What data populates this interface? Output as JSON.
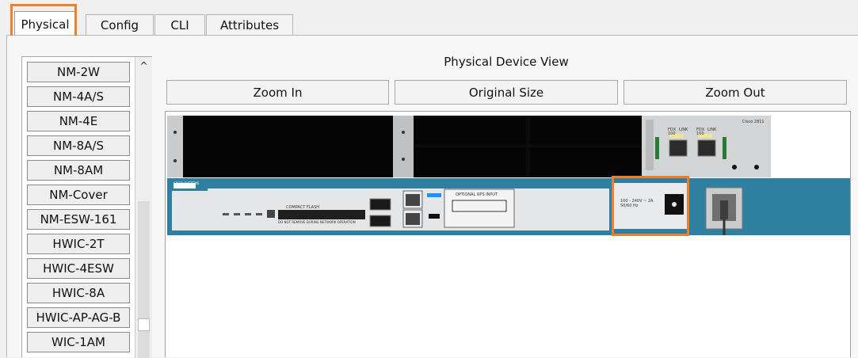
{
  "tabs": [
    {
      "label": "Physical",
      "active": true
    },
    {
      "label": "Config",
      "active": false
    },
    {
      "label": "CLI",
      "active": false
    },
    {
      "label": "Attributes",
      "active": false
    }
  ],
  "modules": [
    "NM-2W",
    "NM-4A/S",
    "NM-4E",
    "NM-8A/S",
    "NM-8AM",
    "NM-Cover",
    "NM-ESW-161",
    "HWIC-2T",
    "HWIC-4ESW",
    "HWIC-8A",
    "HWIC-AP-AG-B",
    "WIC-1AM"
  ],
  "device_view": {
    "title": "Physical Device View",
    "zoom_in": "Zoom In",
    "original_size": "Original Size",
    "zoom_out": "Zoom Out"
  },
  "router": {
    "brand": "Cisco 2811",
    "logo": "CISCO SYSTEMS",
    "compact_flash": "COMPACT FLASH",
    "cf_warning": "DO NOT REMOVE DURING NETWORK OPERATION",
    "rps_label": "OPTIONAL RPS INPUT",
    "power_rating": "100 - 240V ~ 2A 50/60 Hz",
    "port_labels": [
      "FDX",
      "100",
      "LINK",
      "FDX",
      "100",
      "LINK"
    ]
  },
  "colors": {
    "highlight": "#ee7f2d",
    "chassis_teal": "#2e7fa0",
    "chassis_face": "#e4e6e8",
    "slot_black": "#0b0b0b"
  }
}
